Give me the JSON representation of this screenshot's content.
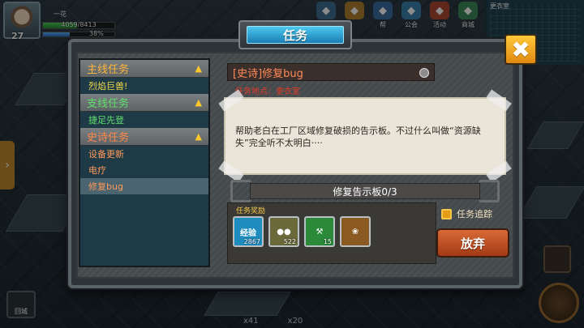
{
  "player": {
    "level": "27",
    "name": "一花",
    "hp_text": "4059/8413",
    "hp_fraction": 0.48,
    "xp_text": "38%",
    "xp_fraction": 0.38
  },
  "top_menu": [
    {
      "label": "",
      "icon": "chest-icon",
      "color": "#3e6f93"
    },
    {
      "label": "",
      "icon": "mail-icon",
      "color": "#b0802f"
    },
    {
      "label": "帮",
      "icon": "help-icon",
      "color": "#3a6fa0"
    },
    {
      "label": "公会",
      "icon": "guild-icon",
      "color": "#3a84b0"
    },
    {
      "label": "活动",
      "icon": "activity-icon",
      "color": "#b04a30"
    },
    {
      "label": "商城",
      "icon": "shop-icon",
      "color": "#3c8a5a"
    }
  ],
  "minimap": {
    "label": "更衣室"
  },
  "hud": {
    "return_label": "回城",
    "pet_counts": [
      "x41",
      "x20"
    ]
  },
  "dialog": {
    "title": "任务",
    "close_symbol": "✖",
    "categories": [
      {
        "title": "主线任务",
        "title_color": "#ffb63c",
        "quests": [
          {
            "name": "烈焰巨兽!",
            "color": "#f0d84a",
            "selected": false
          }
        ]
      },
      {
        "title": "支线任务",
        "title_color": "#5fe06a",
        "quests": [
          {
            "name": "捷足先登",
            "color": "#5fe06a",
            "selected": false
          }
        ]
      },
      {
        "title": "史诗任务",
        "title_color": "#ff8a4a",
        "quests": [
          {
            "name": "设备更新",
            "color": "#ff9a5a",
            "selected": false
          },
          {
            "name": "电疗",
            "color": "#ff9a5a",
            "selected": false
          },
          {
            "name": "修复bug",
            "color": "#ff9a5a",
            "selected": true
          }
        ]
      }
    ],
    "detail": {
      "name": "[史诗]修复bug",
      "location": "任务地点：更衣室",
      "description": "帮助老白在工厂区域修复破损的告示板。不过什么叫做“资源缺失”完全听不太明白····",
      "progress": "修复告示板0/3",
      "reward_label": "任务奖励",
      "rewards": [
        {
          "icon": "experience-icon",
          "text": "经验",
          "qty": "2867",
          "color": "#1f8cc0"
        },
        {
          "icon": "gold-coins-icon",
          "text": "●●",
          "qty": "522",
          "color": "#6b6a3a"
        },
        {
          "icon": "hammer-icon",
          "text": "⚒",
          "qty": "15",
          "color": "#2a8a3a"
        },
        {
          "icon": "scroll-icon",
          "text": "❀",
          "qty": "",
          "color": "#8a5a22"
        }
      ],
      "track_label": "任务追踪",
      "abandon_label": "放弃"
    }
  }
}
